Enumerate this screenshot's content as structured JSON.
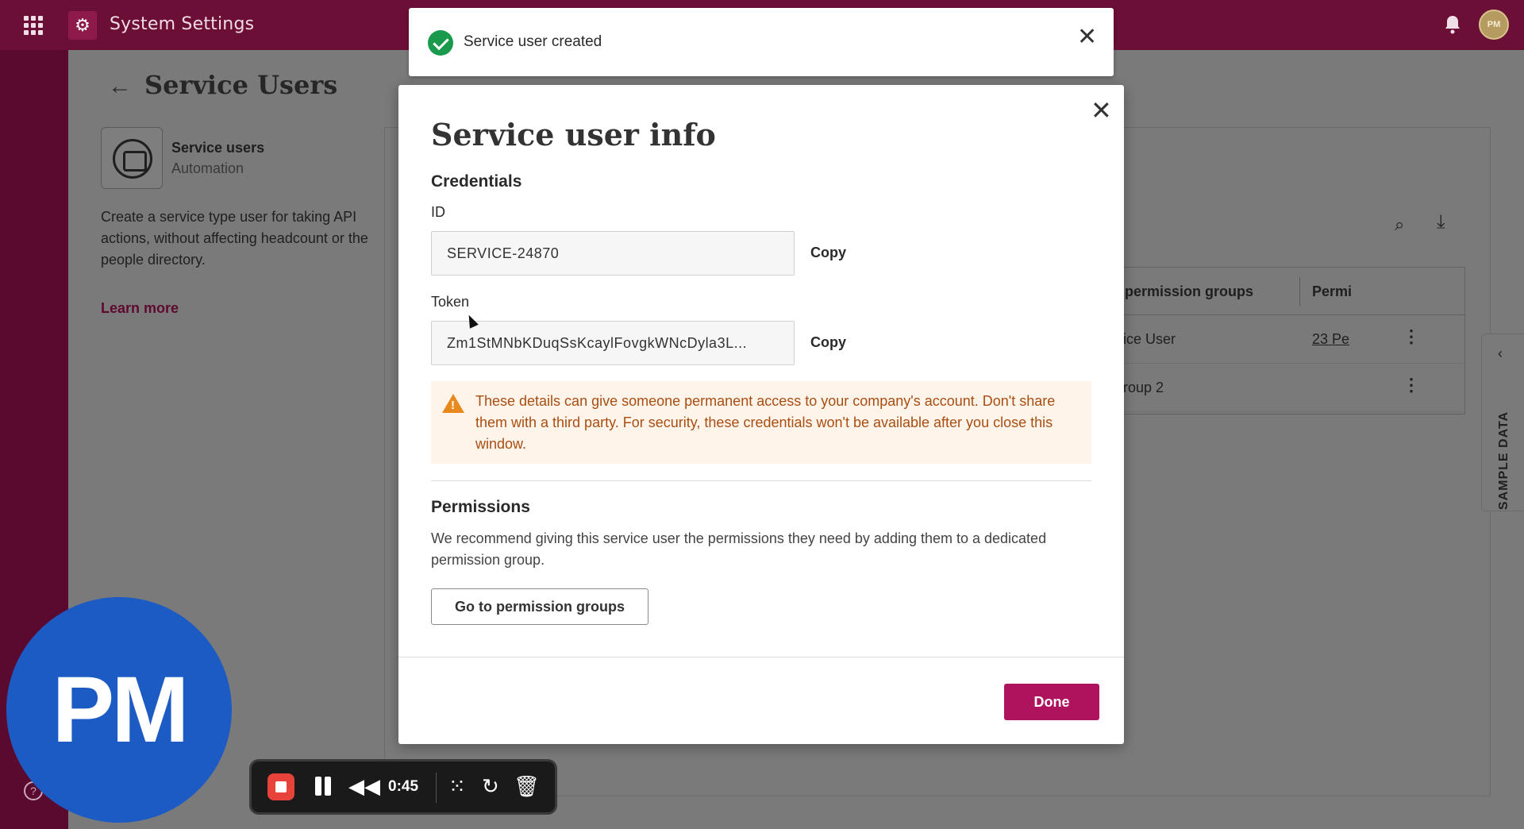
{
  "app": {
    "title": "System Settings",
    "avatar_initials": "PM"
  },
  "page": {
    "title": "Service Users",
    "card_title": "Service users",
    "card_subtitle": "Automation",
    "description": "Create a service type user for taking API actions, without affecting headcount or the people directory.",
    "learn_more": "Learn more"
  },
  "table": {
    "headers": [
      "permission groups",
      "Permi"
    ],
    "rows": [
      {
        "name": "ice User",
        "perm": "23 Pe"
      },
      {
        "name": "roup 2",
        "perm": ""
      }
    ]
  },
  "sample_tab": {
    "label": "SAMPLE DATA"
  },
  "toast": {
    "message": "Service user created"
  },
  "modal": {
    "title": "Service user info",
    "credentials_heading": "Credentials",
    "id_label": "ID",
    "id_value": "SERVICE-24870",
    "token_label": "Token",
    "token_value": "Zm1StMNbKDuqSsKcaylFovgkWNcDyla3L...",
    "copy_label": "Copy",
    "warning": "These details can give someone permanent access to your company's account. Don't share them with a third party. For security, these credentials won't be available after you close this window.",
    "permissions_heading": "Permissions",
    "permissions_desc": "We recommend giving this service user the permissions they need by adding them to a dedicated permission group.",
    "permissions_button": "Go to permission groups",
    "done_label": "Done"
  },
  "webcam": {
    "initials": "PM"
  },
  "recorder": {
    "time": "0:45"
  },
  "colors": {
    "brand": "#6b0f37",
    "primary_button": "#b0135d",
    "success": "#1a9a4c",
    "warning": "#e8891d",
    "webcam": "#1d5bc4"
  }
}
